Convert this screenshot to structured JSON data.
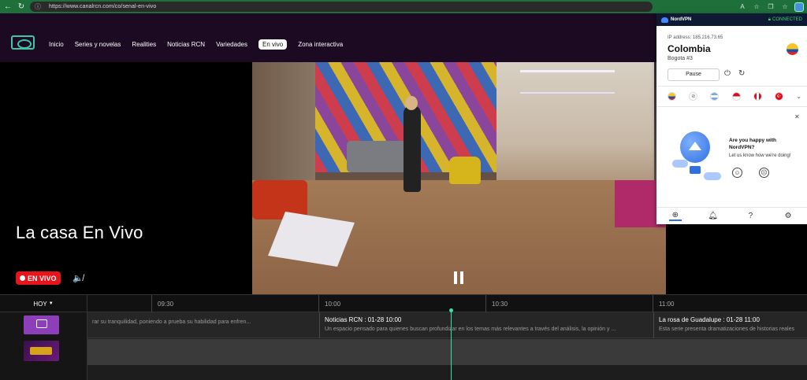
{
  "browser": {
    "url": "https://www.canalrcn.com/co/senal-en-vivo"
  },
  "site": {
    "menu": [
      "Inicio",
      "Series y novelas",
      "Realities",
      "Noticias RCN",
      "Variedades",
      "En vivo",
      "Zona interactiva"
    ],
    "active_menu": "En vivo"
  },
  "hero": {
    "title": "La casa En Vivo",
    "live_label": "EN VIVO"
  },
  "guide": {
    "day": "HOY",
    "times": [
      "09:30",
      "10:00",
      "10:30",
      "11:00"
    ],
    "programs": [
      {
        "title": "",
        "desc": "rar su tranquilidad, poniendo a prueba su habilidad para enfren..."
      },
      {
        "title": "Noticias RCN : 01-28 10:00",
        "desc": "Un espacio pensado para quienes buscan profundizar en los temas más relevantes a través del análisis, la opinión y ..."
      },
      {
        "title": "La rosa de Guadalupe : 01-28 11:00",
        "desc": "Esta serie presenta dramatizaciones de historias reales"
      }
    ]
  },
  "vpn": {
    "brand": "NordVPN",
    "status": "CONNECTED",
    "ip": "IP address: 185.216.73.65",
    "country": "Colombia",
    "server": "Bogota #3",
    "pause_label": "Pause",
    "promo_question": "Are you happy with NordVPN?",
    "promo_sub": "Let us know how we're doing!"
  },
  "colors": {
    "header_bg": "#1b0a22",
    "live_red": "#e8141c",
    "playhead": "#3be0a2",
    "vpn_connected": "#3bd46d"
  }
}
